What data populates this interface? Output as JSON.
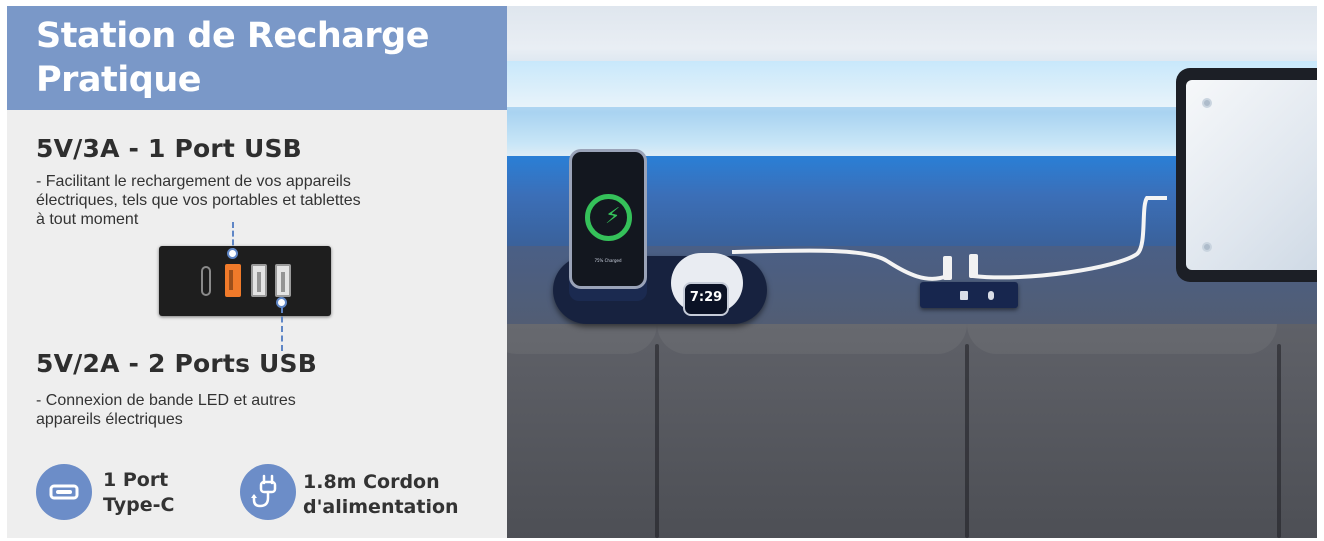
{
  "banner": {
    "title": "Station de Recharge\nPratique"
  },
  "port_usb_3a": {
    "heading": "5V/3A - 1 Port USB",
    "description": " - Facilitant le rechargement de vos appareils\nélectriques, tels que vos portables et tablettes\nà tout moment"
  },
  "ports_usb_2a": {
    "heading": "5V/2A - 2 Ports USB",
    "description": " - Connexion de bande LED et autres\nappareils électriques"
  },
  "features": [
    {
      "icon": "usb-c-port-icon",
      "label": "1 Port\nType-C"
    },
    {
      "icon": "power-cord-icon",
      "label": "1.8m Cordon\nd'alimentation"
    }
  ],
  "scene": {
    "phone_status": "75% Charged",
    "watch_time": "7:29"
  },
  "colors": {
    "accent": "#7a98c8",
    "icon_circle": "#6c8dc8",
    "usb_fast_port": "#f07a2a",
    "panel_bg": "#eeeeee"
  }
}
